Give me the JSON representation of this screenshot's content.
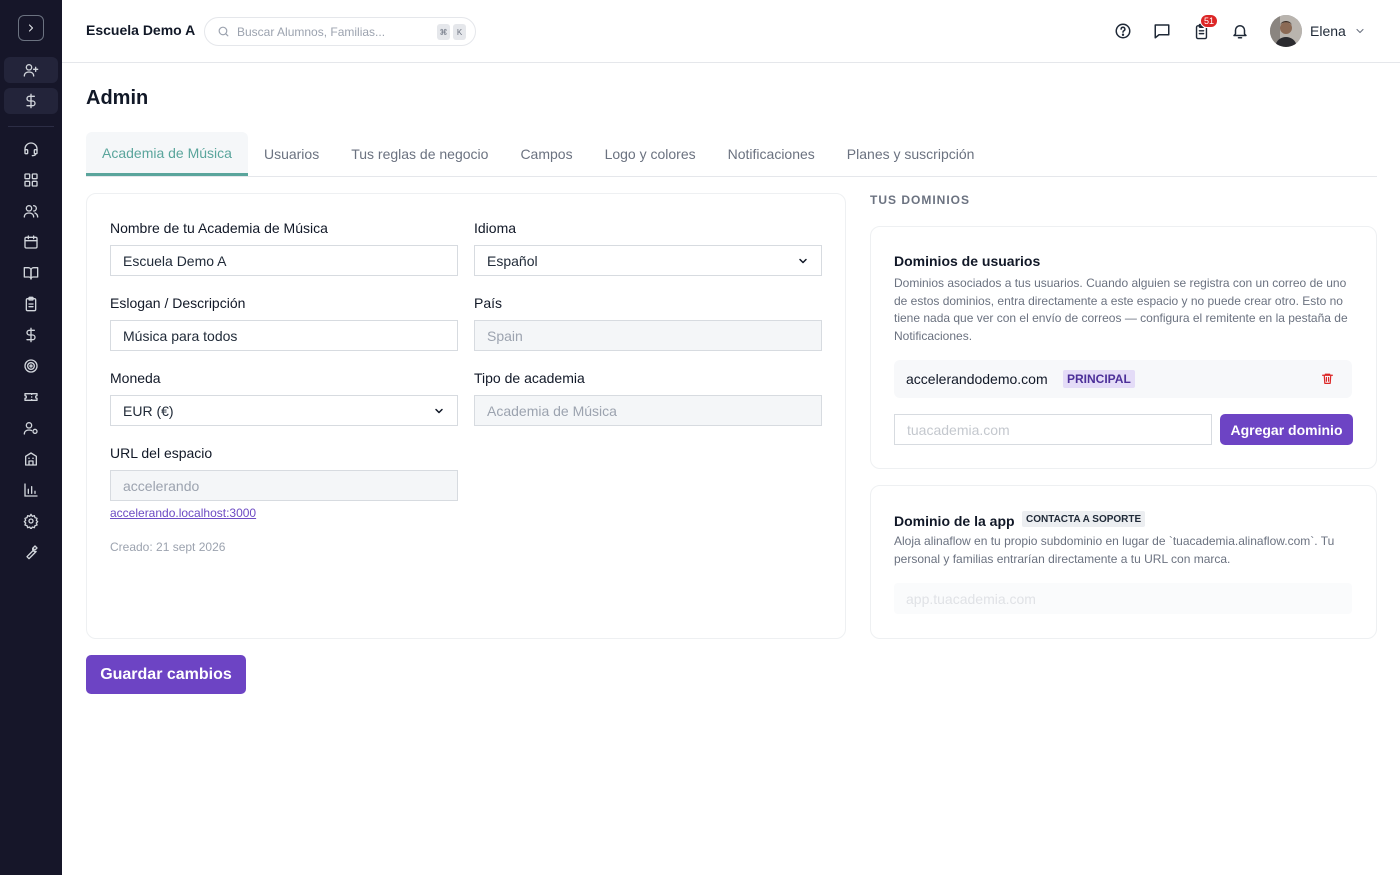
{
  "colors": {
    "sidebar_bg": "#161629",
    "accent": "#6d44c4",
    "tab_active": "#5aa59c",
    "danger": "#dc2626"
  },
  "sidebar": {
    "toggle_icon": "chevron-right-icon",
    "items": [
      "user-plus-icon",
      "dollar-icon",
      "headset-icon",
      "grid-icon",
      "users-icon",
      "calendar-icon",
      "book-icon",
      "clipboard-icon",
      "dollar-icon",
      "target-icon",
      "ticket-icon",
      "user-cog-icon",
      "building-icon",
      "bar-chart-icon",
      "gear-icon",
      "wrench-icon"
    ]
  },
  "header": {
    "school_name": "Escuela Demo A",
    "search_placeholder": "Buscar Alumnos, Familias...",
    "kbd_1": "⌘",
    "kbd_2": "K",
    "notification_count": "51",
    "user_name": "Elena"
  },
  "page": {
    "title": "Admin"
  },
  "tabs": [
    {
      "label": "Academia de Música"
    },
    {
      "label": "Usuarios"
    },
    {
      "label": "Tus reglas de negocio"
    },
    {
      "label": "Campos"
    },
    {
      "label": "Logo y colores"
    },
    {
      "label": "Notificaciones"
    },
    {
      "label": "Planes y suscripción"
    }
  ],
  "form": {
    "name_label": "Nombre de tu Academia de Música",
    "name_value": "Escuela Demo A",
    "language_label": "Idioma",
    "language_value": "Español",
    "slogan_label": "Eslogan / Descripción",
    "slogan_value": "Música para todos",
    "country_label": "País",
    "country_value": "Spain",
    "currency_label": "Moneda",
    "currency_value": "EUR (€)",
    "type_label": "Tipo de academia",
    "type_value": "Academia de Música",
    "url_label": "URL del espacio",
    "url_value": "accelerando",
    "url_link": "accelerando.localhost:3000",
    "created": "Creado: 21 sept 2026"
  },
  "domains": {
    "section_title": "TUS DOMINIOS",
    "user_title": "Dominios de usuarios",
    "user_desc": "Dominios asociados a tus usuarios. Cuando alguien se registra con un correo de uno de estos dominios, entra directamente a este espacio y no puede crear otro. Esto no tiene nada que ver con el envío de correos — configura el remitente en la pestaña de Notificaciones.",
    "domain_name": "accelerandodemo.com",
    "domain_badge": "PRINCIPAL",
    "input_placeholder": "tuacademia.com",
    "add_button": "Agregar dominio",
    "app_title": "Dominio de la app",
    "app_badge": "CONTACTA A SOPORTE",
    "app_desc": "Aloja alinaflow en tu propio subdominio en lugar de `tuacademia.alinaflow.com`. Tu personal y familias entrarían directamente a tu URL con marca.",
    "app_placeholder": "app.tuacademia.com"
  },
  "save_button": "Guardar cambios"
}
